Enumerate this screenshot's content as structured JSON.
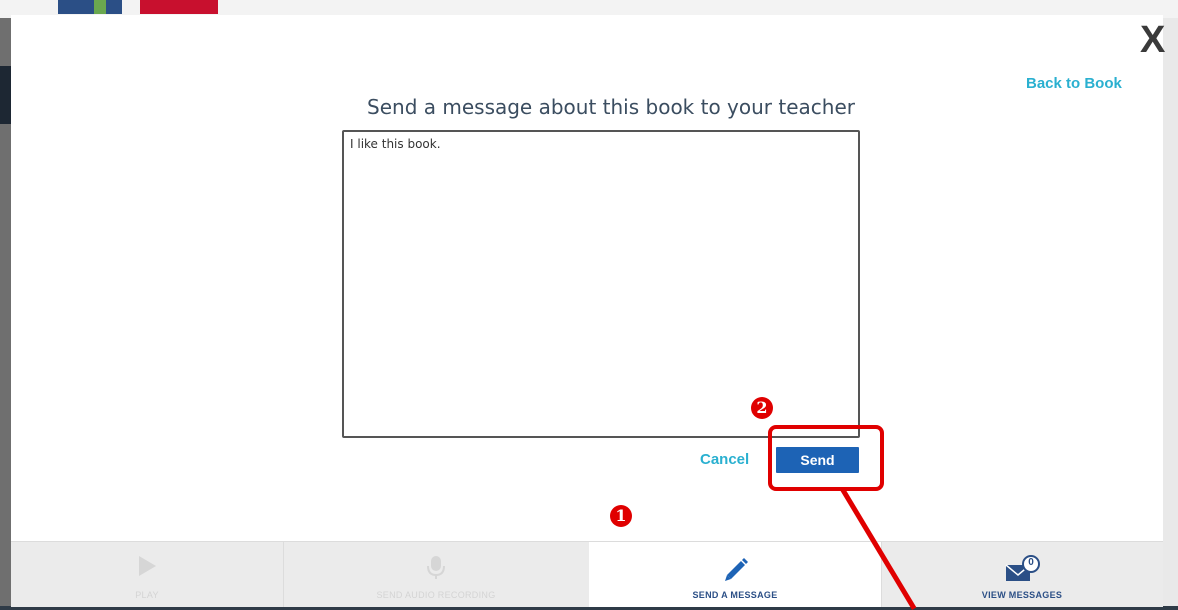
{
  "modal": {
    "close_label": "X",
    "back_link": "Back to Book",
    "title": "Send a message about this book to your teacher",
    "message_value": "I like this book.",
    "cancel_label": "Cancel",
    "send_label": "Send"
  },
  "annotations": {
    "step1": "1",
    "step2": "2",
    "color": "#e00000"
  },
  "toolbar": {
    "items": [
      {
        "label": "PLAY",
        "icon": "play-icon",
        "state": "disabled"
      },
      {
        "label": "SEND AUDIO RECORDING",
        "icon": "microphone-icon",
        "state": "disabled"
      },
      {
        "label": "SEND A MESSAGE",
        "icon": "pencil-icon",
        "state": "active"
      },
      {
        "label": "VIEW MESSAGES",
        "icon": "envelope-icon",
        "state": "enabled",
        "badge_count": "0"
      }
    ]
  },
  "colors": {
    "accent_link": "#2ab0d0",
    "primary_button": "#1d63b5",
    "nav_text": "#2b4f86"
  }
}
